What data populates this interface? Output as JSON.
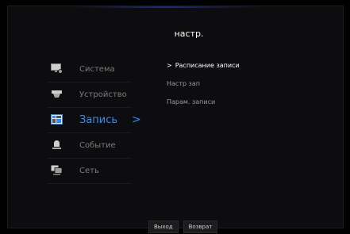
{
  "header": {
    "title": "настр."
  },
  "menu": {
    "items": [
      {
        "label": "Система",
        "icon": "monitor-gear-icon"
      },
      {
        "label": "Устройство",
        "icon": "camera-icon"
      },
      {
        "label": "Запись",
        "icon": "recording-grid-icon",
        "active": true
      },
      {
        "label": "Событие",
        "icon": "alarm-bell-icon"
      },
      {
        "label": "Сеть",
        "icon": "network-monitors-icon"
      }
    ],
    "active_chevron": ">"
  },
  "submenu": {
    "items": [
      {
        "label": "Расписание записи",
        "selected": true,
        "marker": ">"
      },
      {
        "label": "Настр зап"
      },
      {
        "label": "Парам. записи"
      }
    ]
  },
  "footer": {
    "exit_label": "Выход",
    "back_label": "Возврат"
  },
  "colors": {
    "accent": "#2f8df0",
    "text_dim": "#7c7c7c",
    "background": "#0d0d0f"
  }
}
